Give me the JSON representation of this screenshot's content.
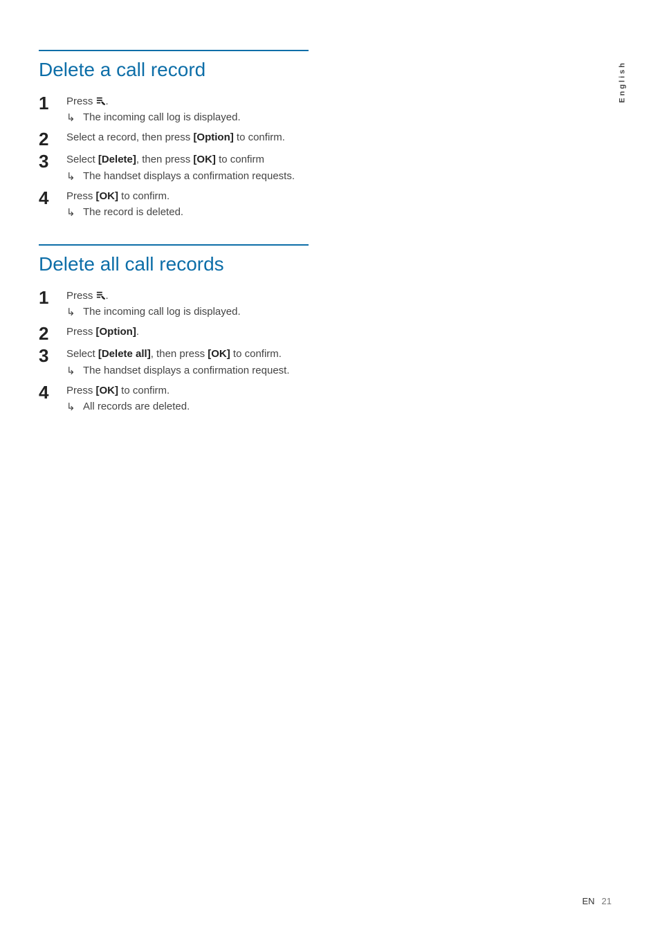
{
  "language_tab": "English",
  "sections": [
    {
      "title": "Delete a call record",
      "steps": [
        {
          "num": "1",
          "pre": "Press ",
          "icon": true,
          "post": ".",
          "result": "The incoming call log is displayed."
        },
        {
          "num": "2",
          "pre": "Select a record, then press ",
          "b1": "[Option]",
          "mid": " to confirm.",
          "result": null
        },
        {
          "num": "3",
          "pre": "Select ",
          "b1": "[Delete]",
          "mid": ", then press ",
          "b2": "[OK]",
          "post": " to confirm",
          "result": "The handset displays a confirmation requests."
        },
        {
          "num": "4",
          "pre": "Press ",
          "b1": "[OK]",
          "mid": " to confirm.",
          "result": "The record is deleted."
        }
      ]
    },
    {
      "title": "Delete all call records",
      "steps": [
        {
          "num": "1",
          "pre": "Press ",
          "icon": true,
          "post": ".",
          "result": "The incoming call log is displayed."
        },
        {
          "num": "2",
          "pre": "Press ",
          "b1": "[Option]",
          "mid": ".",
          "result": null
        },
        {
          "num": "3",
          "pre": "Select ",
          "b1": "[Delete all]",
          "mid": ", then press ",
          "b2": "[OK]",
          "post": " to confirm.",
          "result": "The handset displays a confirmation request."
        },
        {
          "num": "4",
          "pre": "Press ",
          "b1": "[OK]",
          "mid": " to confirm.",
          "result": "All records are deleted."
        }
      ]
    }
  ],
  "footer": {
    "lang": "EN",
    "page": "21"
  }
}
